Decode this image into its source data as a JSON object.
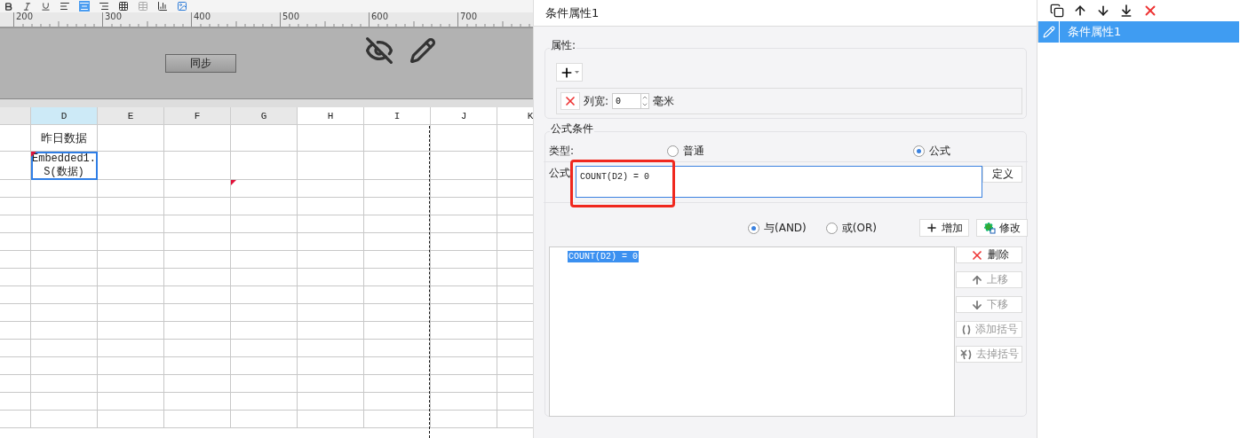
{
  "ruler": {
    "labels": [
      "200",
      "300",
      "400",
      "500",
      "600",
      "700"
    ]
  },
  "form": {
    "sync_button": "同步"
  },
  "sheet": {
    "columns": [
      {
        "label": "D",
        "selected": true
      },
      {
        "label": "E",
        "selected": false
      },
      {
        "label": "F",
        "selected": false
      },
      {
        "label": "G",
        "selected": false
      },
      {
        "label": "H",
        "selected": false
      },
      {
        "label": "I",
        "selected": false
      },
      {
        "label": "J",
        "selected": false
      },
      {
        "label": "K",
        "selected": false
      }
    ],
    "rows": [
      {
        "cells": [
          {
            "text": "昨日数据",
            "selected": false,
            "marked": false
          },
          {
            "selected": false,
            "marked": false
          },
          {
            "selected": false,
            "marked": false
          },
          {
            "selected": false,
            "marked": false
          },
          {
            "selected": false,
            "marked": false
          },
          {
            "selected": false,
            "marked": false
          },
          {
            "selected": false,
            "marked": false
          },
          {
            "selected": false,
            "marked": false
          }
        ]
      },
      {
        "cells": [
          {
            "text": "Embedded1.\nS(数据)",
            "selected": true,
            "marked": true
          },
          {
            "selected": false,
            "marked": false
          },
          {
            "selected": false,
            "marked": false
          },
          {
            "selected": false,
            "marked": false
          },
          {
            "selected": false,
            "marked": false
          },
          {
            "selected": false,
            "marked": false
          },
          {
            "selected": false,
            "marked": false
          },
          {
            "selected": false,
            "marked": false
          }
        ]
      },
      {
        "cells": [
          {
            "selected": false,
            "marked": false
          },
          {
            "selected": false,
            "marked": false
          },
          {
            "selected": false,
            "marked": false
          },
          {
            "selected": false,
            "marked": true
          },
          {
            "selected": false,
            "marked": false
          },
          {
            "selected": false,
            "marked": false
          },
          {
            "selected": false,
            "marked": false
          },
          {
            "selected": false,
            "marked": false
          }
        ]
      }
    ]
  },
  "dialog": {
    "title": "条件属性1",
    "properties": {
      "legend": "属性:",
      "column_width": {
        "label": "列宽:",
        "value": "0",
        "unit": "毫米"
      }
    },
    "formula_condition": {
      "legend": "公式条件",
      "type_label": "类型:",
      "types": [
        {
          "label": "普通",
          "selected": false
        },
        {
          "label": "公式",
          "selected": true
        }
      ],
      "formula_label": "公式",
      "formula_value": "COUNT(D2) = 0",
      "highlighted": true,
      "define_button": "定义",
      "joins": [
        {
          "label": "与(AND)",
          "selected": true
        },
        {
          "label": "或(OR)",
          "selected": false
        }
      ],
      "add_button": "增加",
      "modify_button": "修改",
      "conditions": [
        {
          "text": "COUNT(D2) = 0",
          "selected": true
        }
      ],
      "side_buttons": [
        {
          "kind": "delete",
          "label": "删除",
          "disabled": false
        },
        {
          "kind": "up",
          "label": "上移",
          "disabled": true
        },
        {
          "kind": "down",
          "label": "下移",
          "disabled": true
        },
        {
          "kind": "add-paren",
          "label": "添加括号",
          "disabled": true
        },
        {
          "kind": "remove-paren",
          "label": "去掉括号",
          "disabled": true
        }
      ]
    }
  },
  "attribute_list": {
    "items": [
      {
        "label": "条件属性1",
        "selected": true
      }
    ]
  }
}
